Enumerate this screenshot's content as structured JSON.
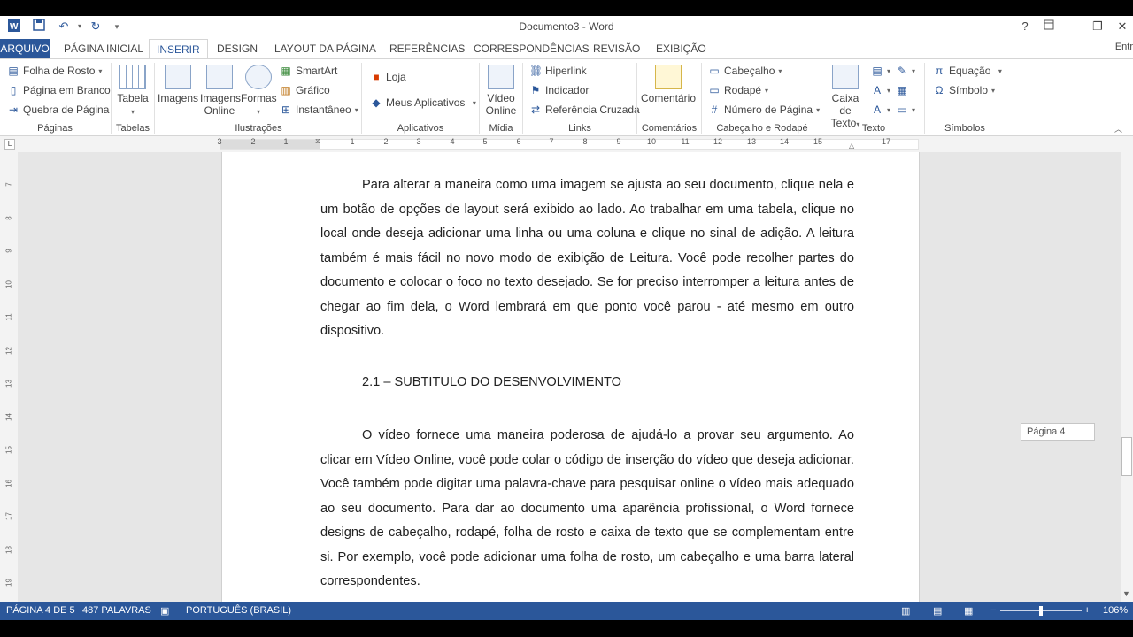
{
  "window": {
    "title": "Documento3 - Word",
    "help": "?",
    "minimize": "—",
    "restore": "❐",
    "close": "✕"
  },
  "quick_access": {
    "undo": "↶",
    "redo": "↻"
  },
  "tabs": {
    "file": "ARQUIVO",
    "home": "PÁGINA INICIAL",
    "insert": "INSERIR",
    "design": "DESIGN",
    "layout": "LAYOUT DA PÁGINA",
    "references": "REFERÊNCIAS",
    "mailings": "CORRESPONDÊNCIAS",
    "review": "REVISÃO",
    "view": "EXIBIÇÃO",
    "signin": "Entr"
  },
  "ribbon": {
    "pages": {
      "cover": "Folha de Rosto",
      "blank": "Página em Branco",
      "break": "Quebra de Página",
      "label": "Páginas"
    },
    "tables": {
      "table": "Tabela",
      "label": "Tabelas"
    },
    "illustrations": {
      "images": "Imagens",
      "online_images_1": "Imagens",
      "online_images_2": "Online",
      "shapes": "Formas",
      "smartart": "SmartArt",
      "chart": "Gráfico",
      "screenshot": "Instantâneo",
      "label": "Ilustrações"
    },
    "apps": {
      "store": "Loja",
      "my_apps": "Meus Aplicativos",
      "label": "Aplicativos"
    },
    "media": {
      "video_1": "Vídeo",
      "video_2": "Online",
      "label": "Mídia"
    },
    "links": {
      "hyperlink": "Hiperlink",
      "bookmark": "Indicador",
      "crossref": "Referência Cruzada",
      "label": "Links"
    },
    "comments": {
      "comment": "Comentário",
      "label": "Comentários"
    },
    "header_footer": {
      "header": "Cabeçalho",
      "footer": "Rodapé",
      "page_number": "Número de Página",
      "label": "Cabeçalho e Rodapé"
    },
    "text": {
      "textbox_1": "Caixa de",
      "textbox_2": "Texto",
      "label": "Texto"
    },
    "symbols": {
      "equation": "Equação",
      "symbol": "Símbolo",
      "label": "Símbolos"
    }
  },
  "ruler": {
    "ticks": [
      "3",
      "2",
      "1",
      "1",
      "2",
      "3",
      "4",
      "5",
      "6",
      "7",
      "8",
      "9",
      "10",
      "11",
      "12",
      "13",
      "14",
      "15",
      "17"
    ]
  },
  "vruler": {
    "ticks": [
      "7",
      "8",
      "9",
      "10",
      "11",
      "12",
      "13",
      "14",
      "15",
      "16",
      "17",
      "18",
      "19"
    ]
  },
  "document": {
    "para1": "Para alterar a maneira como uma imagem se ajusta ao seu documento, clique nela e um botão de opções de layout será exibido ao lado. Ao trabalhar em uma tabela, clique no local onde deseja adicionar uma linha ou uma coluna e clique no sinal de adição. A leitura também é mais fácil no novo modo de exibição de Leitura. Você pode recolher partes do documento e colocar o foco no texto desejado. Se for preciso interromper a leitura antes de chegar ao fim dela, o Word lembrará em que ponto você parou - até mesmo em outro dispositivo.",
    "heading": "2.1 – SUBTITULO DO DESENVOLVIMENTO",
    "para2": "O vídeo fornece uma maneira poderosa de ajudá-lo a provar seu argumento. Ao clicar em Vídeo Online, você pode colar o código de inserção do vídeo que deseja adicionar. Você também pode digitar uma palavra-chave para pesquisar online o vídeo mais adequado ao seu documento. Para dar ao documento uma aparência profissional, o Word fornece designs de cabeçalho, rodapé, folha de rosto e caixa de texto que se complementam entre si. Por exemplo, você pode adicionar uma folha de rosto, um cabeçalho e uma barra lateral correspondentes."
  },
  "page_tooltip": "Página 4",
  "status": {
    "page": "PÁGINA 4 DE 5",
    "words": "487 PALAVRAS",
    "language": "PORTUGUÊS (BRASIL)",
    "zoom": "106%"
  }
}
